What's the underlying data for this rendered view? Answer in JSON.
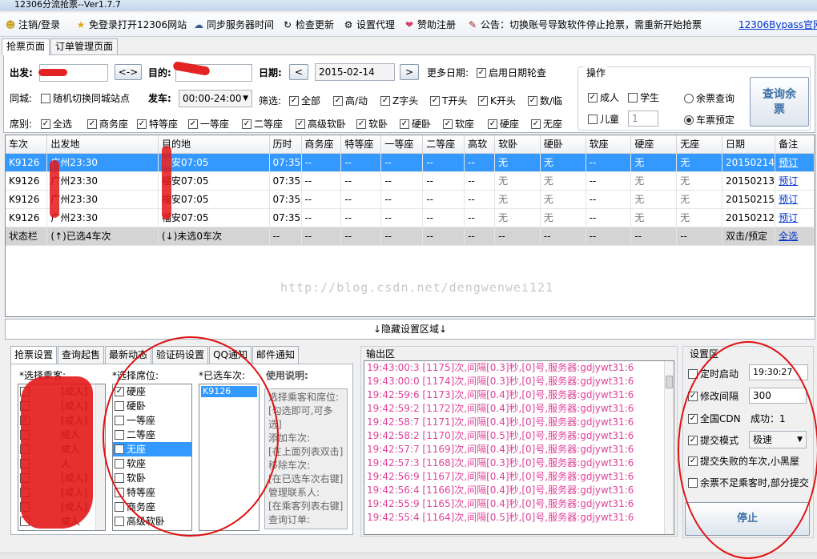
{
  "window": {
    "title": "12306分流抢票--Ver1.7.7"
  },
  "toolbar": {
    "items": [
      {
        "label": "注销/登录",
        "icon": "user-icon"
      },
      {
        "label": "免登录打开12306网站",
        "icon": "star-icon"
      },
      {
        "label": "同步服务器时间",
        "icon": "cloud-icon"
      },
      {
        "label": "检查更新",
        "icon": "refresh-icon"
      },
      {
        "label": "设置代理",
        "icon": "gear-icon"
      },
      {
        "label": "赞助注册",
        "icon": "heart-icon"
      },
      {
        "label": "公告：切换账号导致软件停止抢票，需重新开始抢票",
        "icon": "pencil-icon"
      }
    ],
    "right_link": "12306Bypass官网"
  },
  "tabs": [
    "抢票页面",
    "订单管理页面"
  ],
  "search": {
    "from_label": "出发:",
    "to_label": "目的:",
    "swap_label": "<->",
    "date_label": "日期:",
    "date_value": "2015-02-14",
    "prev": "<",
    "next": ">",
    "more_dates_label": "更多日期:",
    "rotate_label": "启用日期轮查",
    "same_city_label": "同城:",
    "random_city_label": "随机切换同城站点",
    "depart_label": "发车:",
    "depart_value": "00:00-24:00",
    "filter_label": "筛选:",
    "filters": [
      "全部",
      "高/动",
      "Z字头",
      "T开头",
      "K开头",
      "数/临"
    ],
    "seat_label": "席别:",
    "seats": [
      "全选",
      "商务座",
      "特等座",
      "一等座",
      "二等座",
      "高级软卧",
      "软卧",
      "硬卧",
      "软座",
      "硬座",
      "无座"
    ]
  },
  "operations": {
    "title": "操作",
    "adult": "成人",
    "student": "学生",
    "child": "儿童",
    "child_count": "1",
    "remain_query": "余票查询",
    "ticket_book": "车票预定",
    "query_button": "查询余票"
  },
  "grid": {
    "headers": [
      "车次",
      "出发地",
      "目的地",
      "历时",
      "商务座",
      "特等座",
      "一等座",
      "二等座",
      "高软",
      "软卧",
      "硬卧",
      "软座",
      "硬座",
      "无座",
      "日期",
      "备注"
    ],
    "rows": [
      [
        "K9126",
        "广州23:30",
        "福安07:05",
        "07:35",
        "--",
        "--",
        "--",
        "--",
        "--",
        "无",
        "无",
        "--",
        "无",
        "无",
        "20150214",
        "预订"
      ],
      [
        "K9126",
        "广州23:30",
        "福安07:05",
        "07:35",
        "--",
        "--",
        "--",
        "--",
        "--",
        "无",
        "无",
        "--",
        "无",
        "无",
        "20150213",
        "预订"
      ],
      [
        "K9126",
        "广州23:30",
        "福安07:05",
        "07:35",
        "--",
        "--",
        "--",
        "--",
        "--",
        "无",
        "无",
        "--",
        "无",
        "无",
        "20150215",
        "预订"
      ],
      [
        "K9126",
        "广州23:30",
        "福安07:05",
        "07:35",
        "--",
        "--",
        "--",
        "--",
        "--",
        "无",
        "无",
        "--",
        "无",
        "无",
        "20150212",
        "预订"
      ]
    ],
    "status_row": [
      "状态栏",
      "(↑)已选4车次",
      "(↓)未选0车次",
      "--",
      "--",
      "--",
      "--",
      "--",
      "--",
      "--",
      "--",
      "--",
      "--",
      "--",
      "双击/预定",
      "全选"
    ]
  },
  "watermark": "http://blog.csdn.net/dengwenwei121",
  "collapse_label": "↓隐藏设置区域↓",
  "bottom_tabs": [
    "抢票设置",
    "查询起售",
    "最新动态",
    "验证码设置",
    "QQ通知",
    "邮件通知"
  ],
  "passengers": {
    "title": "*选择乘客:",
    "items": [
      "[成人]",
      "[成人]",
      "[成人]",
      "成人",
      "成人",
      "人",
      "[成人]",
      "[成人]",
      "[成人]",
      "成人"
    ]
  },
  "seat_select": {
    "title": "*选择席位:",
    "items": [
      "硬座",
      "硬卧",
      "一等座",
      "二等座",
      "无座",
      "软座",
      "软卧",
      "特等座",
      "商务座",
      "高级软卧"
    ],
    "checked": [
      true,
      false,
      false,
      false,
      true,
      false,
      false,
      false,
      false,
      false
    ],
    "selected_index": 4
  },
  "selected_trains": {
    "title": "*已选车次:",
    "items": [
      "K9126"
    ]
  },
  "usage": {
    "title": "使用说明:",
    "text": [
      "选择乘客和席位:",
      "[勾选即可,可多选]",
      "添加车次:",
      "[在上面列表双击]",
      "移除车次:",
      "[在已选车次右键]",
      "管理联系人:",
      "[在乘客列表右键]",
      "查询订单:",
      "[在上面订单管理]"
    ]
  },
  "output": {
    "title": "输出区",
    "lines": [
      "19:43:00:3  [1175]次,间隔[0.3]秒,[0]号,服务器:gdjywt31:6",
      "19:43:00:0  [1174]次,间隔[0.3]秒,[0]号,服务器:gdjywt31:6",
      "19:42:59:6  [1173]次,间隔[0.4]秒,[0]号,服务器:gdjywt31:6",
      "19:42:59:2  [1172]次,间隔[0.4]秒,[0]号,服务器:gdjywt31:6",
      "19:42:58:7  [1171]次,间隔[0.4]秒,[0]号,服务器:gdjywt31:6",
      "19:42:58:2  [1170]次,间隔[0.5]秒,[0]号,服务器:gdjywt31:6",
      "19:42:57:7  [1169]次,间隔[0.4]秒,[0]号,服务器:gdjywt31:6",
      "19:42:57:3  [1168]次,间隔[0.3]秒,[0]号,服务器:gdjywt31:6",
      "19:42:56:9  [1167]次,间隔[0.4]秒,[0]号,服务器:gdjywt31:6",
      "19:42:56:4  [1166]次,间隔[0.4]秒,[0]号,服务器:gdjywt31:6",
      "19:42:55:9  [1165]次,间隔[0.4]秒,[0]号,服务器:gdjywt31:6",
      "19:42:55:4  [1164]次,间隔[0.5]秒,[0]号,服务器:gdjywt31:6"
    ]
  },
  "settings": {
    "title": "设置区",
    "timed_start": "定时启动",
    "timed_value": "19:30:27",
    "modify_interval": "修改间隔",
    "interval_value": "300",
    "global_cdn": "全国CDN",
    "cdn_status": "成功：1",
    "submit_mode": "提交模式",
    "submit_value": "极速",
    "blacklist": "提交失败的车次,小黑屋",
    "partial_submit": "余票不足乘客时,部分提交",
    "stop_button": "停止"
  },
  "colors": {
    "selection": "#3399ff",
    "output_text": "#e0429a",
    "annotation": "#e01010",
    "link": "#0033cc"
  }
}
